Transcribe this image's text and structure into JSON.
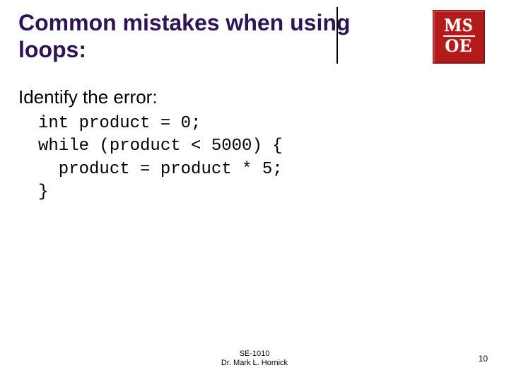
{
  "title": "Common mistakes when using loops:",
  "logo": {
    "row1": "MS",
    "row2": "OE"
  },
  "prompt": "Identify the error:",
  "code": {
    "l1": "int product = 0;",
    "l2": "while (product < 5000) {",
    "l3": "  product = product * 5;",
    "l4": "}"
  },
  "footer": {
    "course": "SE-1010",
    "author": "Dr. Mark L. Hornick"
  },
  "page": "10"
}
